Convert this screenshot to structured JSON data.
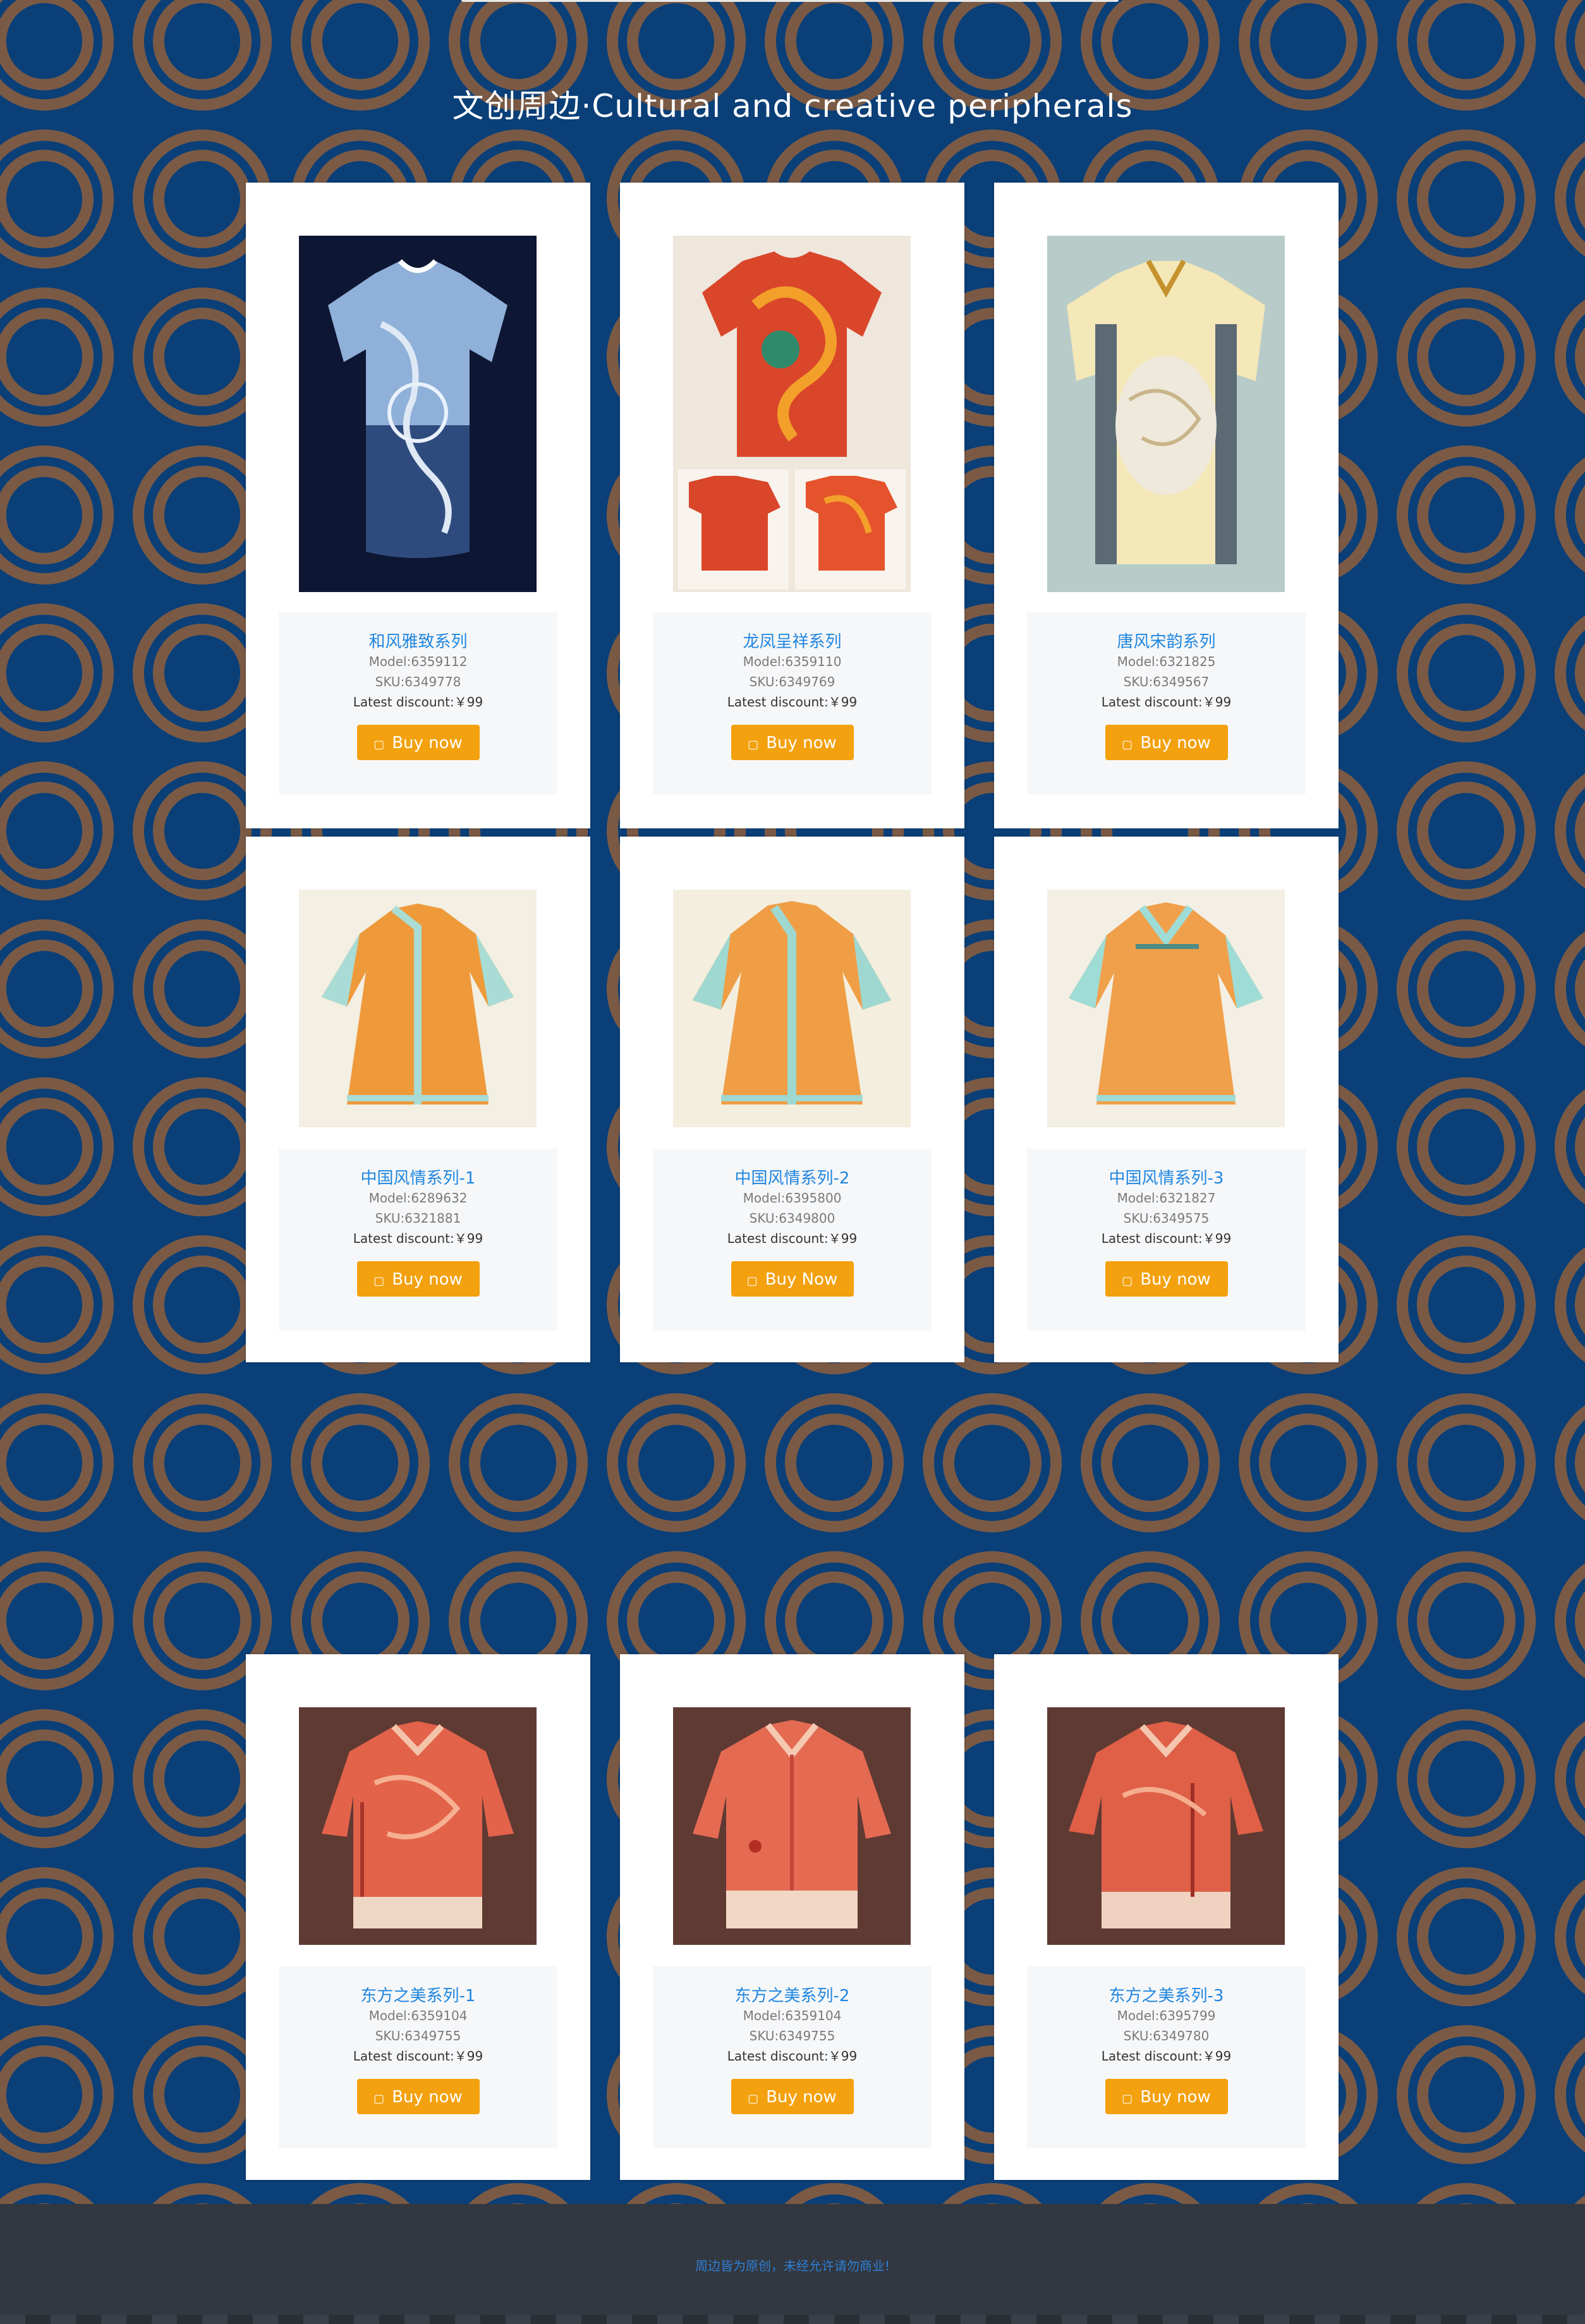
{
  "page": {
    "title": "文创周边·Cultural and creative peripherals"
  },
  "products": [
    {
      "name": "和风雅致系列",
      "model": "Model:6359112",
      "sku": "SKU:6349778",
      "discount": "Latest discount:￥99",
      "button": "Buy now",
      "image": "blue-tshirt-dragon"
    },
    {
      "name": "龙凤呈祥系列",
      "model": "Model:6359110",
      "sku": "SKU:6349769",
      "discount": "Latest discount:￥99",
      "button": "Buy now",
      "image": "red-dragon-tshirt"
    },
    {
      "name": "唐风宋韵系列",
      "model": "Model:6321825",
      "sku": "SKU:6349567",
      "discount": "Latest discount:￥99",
      "button": "Buy now",
      "image": "yellow-tang-robe"
    },
    {
      "name": "中国风情系列-1",
      "model": "Model:6289632",
      "sku": "SKU:6321881",
      "discount": "Latest discount:￥99",
      "button": "Buy now",
      "image": "orange-robe-1"
    },
    {
      "name": "中国风情系列-2",
      "model": "Model:6395800",
      "sku": "SKU:6349800",
      "discount": "Latest discount:￥99",
      "button": "Buy Now",
      "image": "orange-robe-2"
    },
    {
      "name": "中国风情系列-3",
      "model": "Model:6321827",
      "sku": "SKU:6349575",
      "discount": "Latest discount:￥99",
      "button": "Buy now",
      "image": "orange-robe-3"
    },
    {
      "name": "东方之美系列-1",
      "model": "Model:6359104",
      "sku": "SKU:6349755",
      "discount": "Latest discount:￥99",
      "button": "Buy now",
      "image": "coral-hanfu-1"
    },
    {
      "name": "东方之美系列-2",
      "model": "Model:6359104",
      "sku": "SKU:6349755",
      "discount": "Latest discount:￥99",
      "button": "Buy now",
      "image": "coral-hanfu-2"
    },
    {
      "name": "东方之美系列-3",
      "model": "Model:6395799",
      "sku": "SKU:6349780",
      "discount": "Latest discount:￥99",
      "button": "Buy now",
      "image": "coral-hanfu-3"
    }
  ],
  "footer": {
    "text": "周边皆为原创，未经允许请勿商业!"
  },
  "colors": {
    "background": "#0a3f78",
    "pattern": "#7a5a45",
    "accent_link": "#1f86e0",
    "button": "#f3a10f",
    "footer_bg": "#323740"
  }
}
